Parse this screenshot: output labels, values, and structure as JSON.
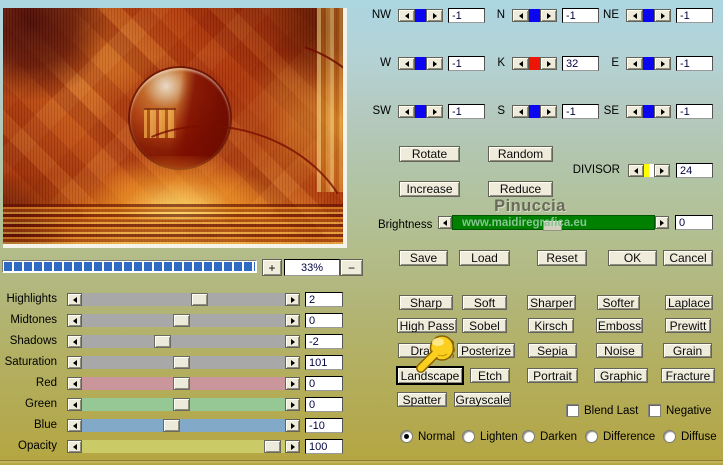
{
  "title_watermark": "Pinuccia",
  "preview": {
    "zoom_level": "33%",
    "zoom_in_label": "+",
    "zoom_out_label": "−"
  },
  "adjustments": {
    "rows": [
      {
        "label": "Highlights",
        "value": "2",
        "thumb_pct": 57.5,
        "track_color": "#a8a8a8"
      },
      {
        "label": "Midtones",
        "value": "0",
        "thumb_pct": 49,
        "track_color": "#a8a8a8"
      },
      {
        "label": "Shadows",
        "value": "-2",
        "thumb_pct": 39.5,
        "track_color": "#a8a8a8"
      },
      {
        "label": "Saturation",
        "value": "101",
        "thumb_pct": 49,
        "track_color": "#a8a8a8"
      },
      {
        "label": "Red",
        "value": "0",
        "thumb_pct": 49,
        "track_color": "#ca959b"
      },
      {
        "label": "Green",
        "value": "0",
        "thumb_pct": 49,
        "track_color": "#96c895"
      },
      {
        "label": "Blue",
        "value": "-10",
        "thumb_pct": 44,
        "track_color": "#82a9c8"
      },
      {
        "label": "Opacity",
        "value": "100",
        "thumb_pct": 93.5,
        "track_color": "#caca66"
      }
    ]
  },
  "directions": [
    {
      "label": "NW",
      "value": "-1",
      "color": "#0b06f2"
    },
    {
      "label": "N",
      "value": "-1",
      "color": "#0b06f2"
    },
    {
      "label": "NE",
      "value": "-1",
      "color": "#0b06f2"
    },
    {
      "label": "W",
      "value": "-1",
      "color": "#0b06f2"
    },
    {
      "label": "K",
      "value": "32",
      "color": "#ee1406"
    },
    {
      "label": "E",
      "value": "-1",
      "color": "#0b06f2"
    },
    {
      "label": "SW",
      "value": "-1",
      "color": "#0b06f2"
    },
    {
      "label": "S",
      "value": "-1",
      "color": "#0b06f2"
    },
    {
      "label": "SE",
      "value": "-1",
      "color": "#0b06f2"
    }
  ],
  "divisor": {
    "label": "DIVISOR",
    "value": "24",
    "color": "#ffff00"
  },
  "transform_buttons": {
    "rotate": "Rotate",
    "random": "Random",
    "increase": "Increase",
    "reduce": "Reduce"
  },
  "brightness": {
    "label": "Brightness",
    "bar_text": "www.maidiregrafica.eu",
    "value": "0",
    "bar_color": "#008001"
  },
  "file_buttons": {
    "save": "Save",
    "load": "Load",
    "reset": "Reset",
    "ok": "OK",
    "cancel": "Cancel"
  },
  "filters": {
    "row1": [
      "Sharp",
      "Soft",
      "Sharper",
      "Softer",
      "Laplace"
    ],
    "row2": [
      "High Pass",
      "Sobel",
      "Kirsch",
      "Emboss",
      "Prewitt"
    ],
    "row3": [
      "Draw",
      "Posterize",
      "Sepia",
      "Noise",
      "Grain"
    ],
    "row4": [
      "Landscape",
      "Etch",
      "Portrait",
      "Graphic",
      "Fracture"
    ],
    "row5": [
      "Spatter",
      "Grayscale"
    ]
  },
  "options": {
    "blend_last": "Blend Last",
    "negative": "Negative"
  },
  "blend_modes": {
    "items": [
      "Normal",
      "Lighten",
      "Darken",
      "Difference",
      "Diffuse"
    ],
    "selected": "Normal"
  }
}
